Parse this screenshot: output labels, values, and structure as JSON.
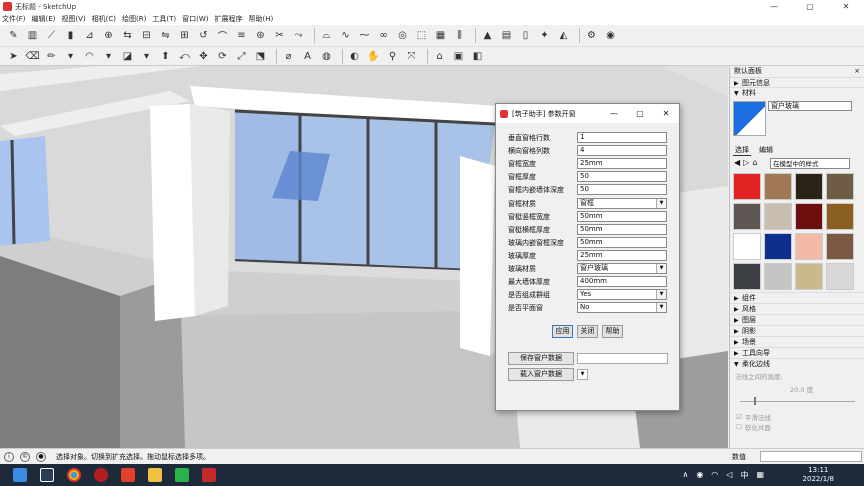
{
  "window": {
    "title": "无标题 - SketchUp",
    "controls": [
      "—",
      "▢",
      "✕"
    ]
  },
  "menu": [
    "文件(F)",
    "编辑(E)",
    "视图(V)",
    "相机(C)",
    "绘图(R)",
    "工具(T)",
    "窗口(W)",
    "扩展程序",
    "帮助(H)"
  ],
  "dialog": {
    "title": "[筑子助手] 参数开窗",
    "controls": [
      "—",
      "▢",
      "✕"
    ],
    "fields": [
      {
        "label": "垂直窗格行数",
        "value": "1",
        "type": "input"
      },
      {
        "label": "横向窗格列数",
        "value": "4",
        "type": "input"
      },
      {
        "label": "窗框宽度",
        "value": "25mm",
        "type": "input"
      },
      {
        "label": "窗框厚度",
        "value": "50",
        "type": "input"
      },
      {
        "label": "窗框内嵌墙体深度",
        "value": "50",
        "type": "input"
      },
      {
        "label": "窗框材质",
        "value": "窗框",
        "type": "select"
      },
      {
        "label": "窗梃竖框宽度",
        "value": "50mm",
        "type": "input"
      },
      {
        "label": "窗梃横框厚度",
        "value": "50mm",
        "type": "input"
      },
      {
        "label": "玻璃内嵌窗框深度",
        "value": "50mm",
        "type": "input"
      },
      {
        "label": "玻璃厚度",
        "value": "25mm",
        "type": "input"
      },
      {
        "label": "玻璃材质",
        "value": "窗户玻璃",
        "type": "select"
      },
      {
        "label": "最大墙体厚度",
        "value": "400mm",
        "type": "input"
      },
      {
        "label": "是否组成群组",
        "value": "Yes",
        "type": "select"
      },
      {
        "label": "是否平面窗",
        "value": "No",
        "type": "select"
      }
    ],
    "buttons": {
      "apply": "应用",
      "close": "关闭",
      "help": "帮助"
    },
    "save_label": "保存窗户数据",
    "load_label": "载入窗户数据"
  },
  "panel": {
    "title": "默认面板",
    "close": "×",
    "entity_info": "图元信息",
    "materials": "材料",
    "material_name": "窗户玻璃",
    "tab_select": "选择",
    "tab_edit": "编辑",
    "collection": "在模型中的样式",
    "sections": [
      "组件",
      "风格",
      "图层",
      "阴影",
      "场景",
      "工具向导",
      "柔化边线"
    ],
    "soft_edges": {
      "angle_label": "法线之间的角度:",
      "angle_value": "20.0",
      "unit": "度",
      "smooth": "平滑法线",
      "soften": "软化共面"
    },
    "swatch_colors": [
      "#e22323",
      "#a07856",
      "#2b2218",
      "#6e5c44",
      "#5e5652",
      "#c9bdb0",
      "#6e0f0f",
      "#8b5e22",
      "#ffffff",
      "#0f2f8f",
      "#f2b8a8",
      "#7a5a44",
      "#3b3e42",
      "#c4c4c4",
      "#c9b98c",
      "#d8d8d8"
    ]
  },
  "status": {
    "text": "选择对象。切换到扩充选择。拖动鼠标选择多项。",
    "value_label": "数值"
  },
  "taskbar": {
    "time": "13:11",
    "date": "2022/1/8",
    "ime": "中",
    "icons": [
      "windows-icon",
      "search-icon",
      "chrome-icon",
      "record-icon",
      "app-icon",
      "folder-icon",
      "wechat-icon",
      "sketchup-icon"
    ]
  }
}
